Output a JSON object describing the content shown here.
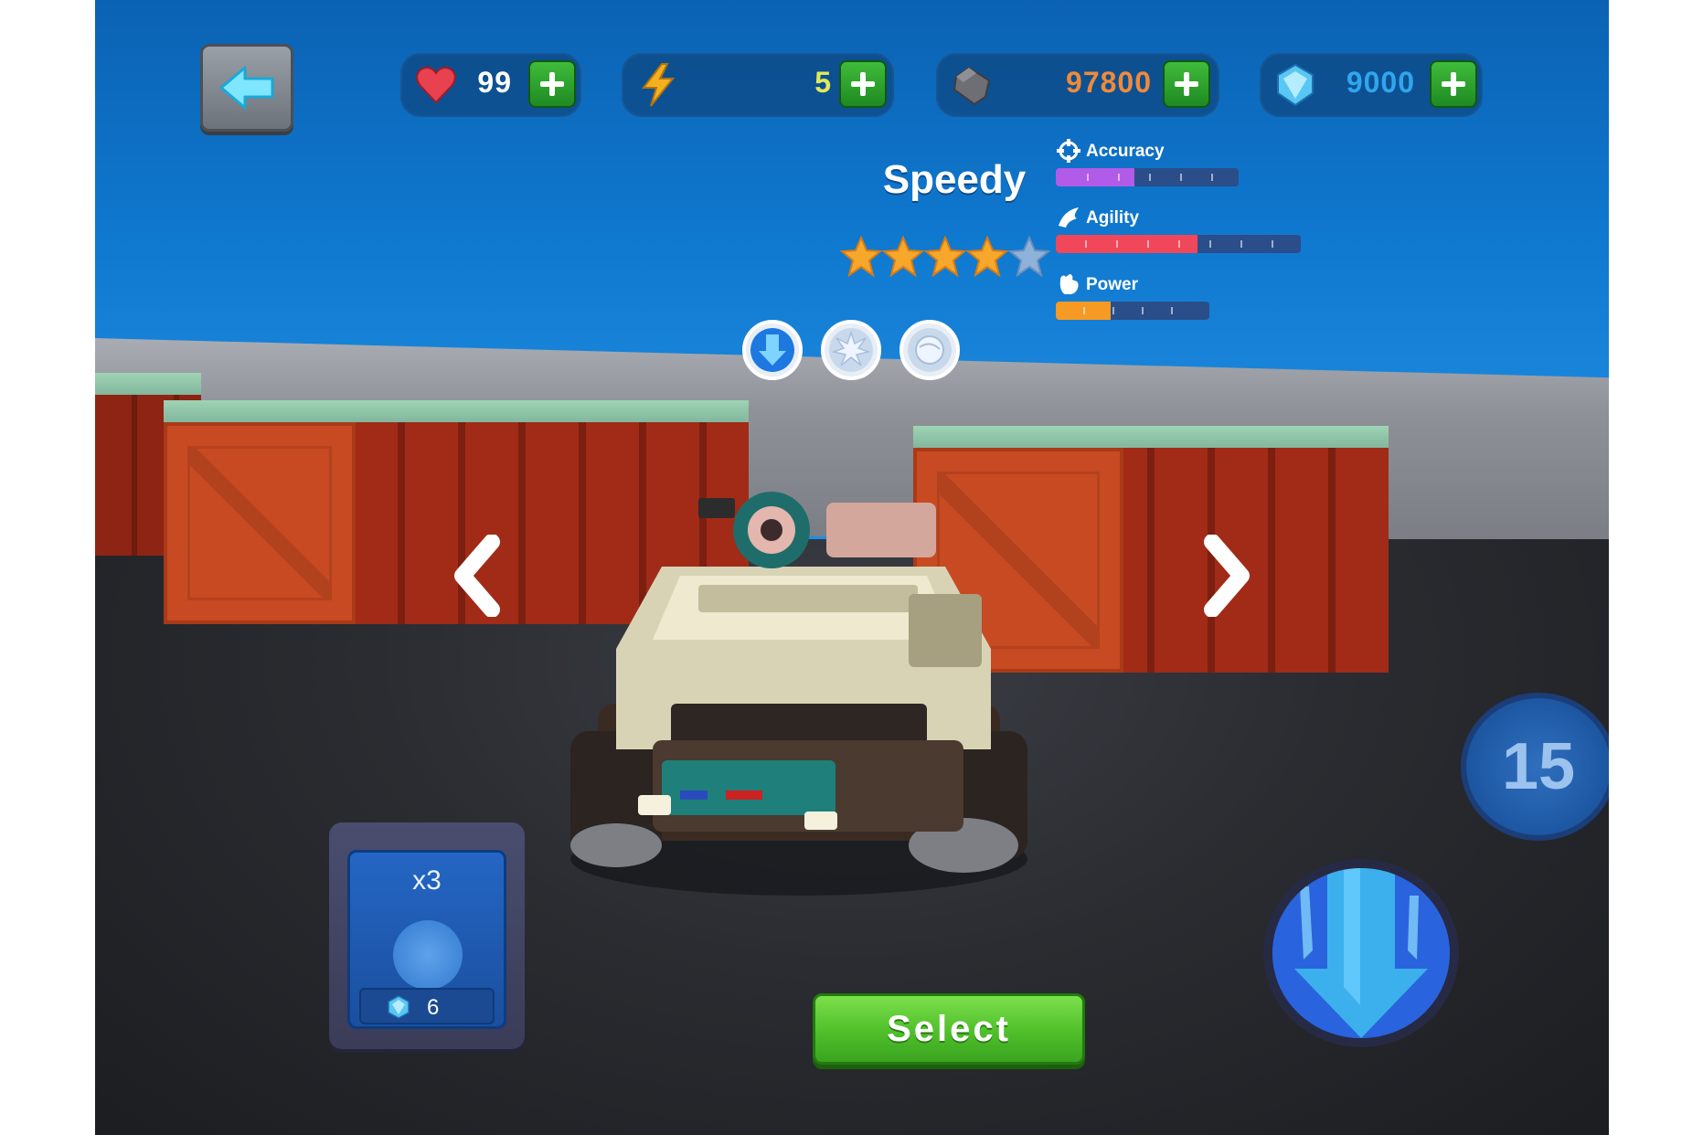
{
  "hud": {
    "health": {
      "value": "99",
      "icon": "heart-icon",
      "color": "#e8414f"
    },
    "energy": {
      "value": "5",
      "icon": "lightning-icon",
      "color": "#f4b11e"
    },
    "coins": {
      "value": "97800",
      "icon": "stone-icon",
      "color": "#f08a3a"
    },
    "gems": {
      "value": "9000",
      "icon": "gem-icon",
      "color": "#2fa6ee"
    }
  },
  "vehicle": {
    "name": "Speedy",
    "stars_filled": 4,
    "stars_total": 5,
    "abilities": [
      {
        "icon": "ice-ability-icon",
        "selected": true
      },
      {
        "icon": "burst-ability-icon",
        "selected": false
      },
      {
        "icon": "orb-ability-icon",
        "selected": false
      }
    ]
  },
  "stats": [
    {
      "label": "Accuracy",
      "icon": "crosshair-icon",
      "color": "#b25be8",
      "level": 0.43
    },
    {
      "label": "Agility",
      "icon": "wing-icon",
      "color": "#f0475a",
      "level": 0.58
    },
    {
      "label": "Power",
      "icon": "fist-icon",
      "color": "#f79a24",
      "level": 0.36
    }
  ],
  "booster": {
    "multiplier": "x3",
    "cost": "6",
    "icon": "gem-icon"
  },
  "select_label": "Select",
  "timer": "15",
  "colors": {
    "accent_green": "#4fbf2a",
    "sky": "#0f78cf"
  }
}
